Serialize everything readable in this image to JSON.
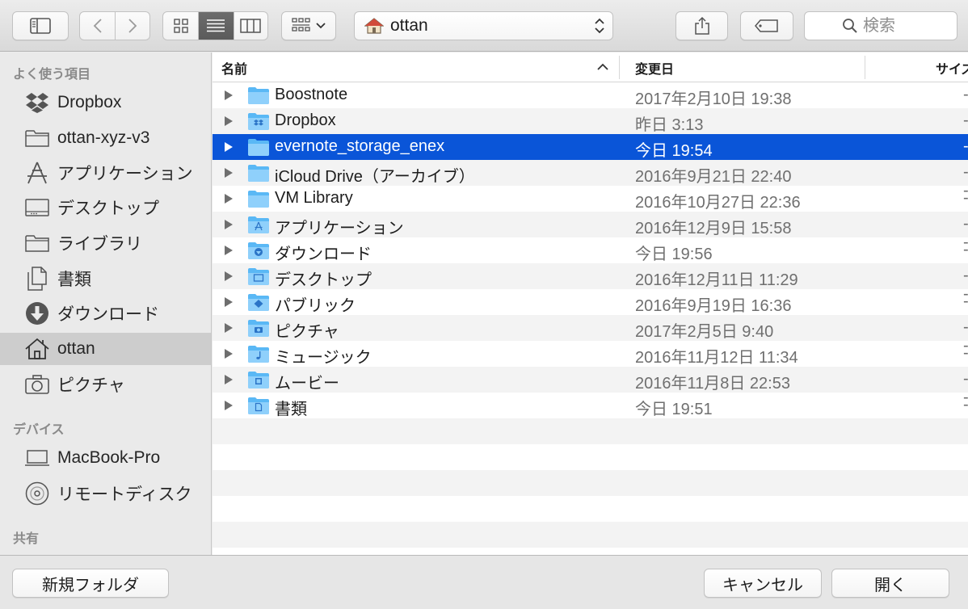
{
  "toolbar": {
    "location": "ottan",
    "search_placeholder": "検索"
  },
  "sidebar": {
    "favorites_header": "よく使う項目",
    "favorites": [
      {
        "label": "Dropbox",
        "icon": "dropbox-icon"
      },
      {
        "label": "ottan-xyz-v3",
        "icon": "folder-icon"
      },
      {
        "label": "アプリケーション",
        "icon": "applications-icon"
      },
      {
        "label": "デスクトップ",
        "icon": "desktop-icon"
      },
      {
        "label": "ライブラリ",
        "icon": "folder-icon"
      },
      {
        "label": "書類",
        "icon": "documents-icon"
      },
      {
        "label": "ダウンロード",
        "icon": "download-icon"
      },
      {
        "label": "ottan",
        "icon": "home-icon",
        "selected": true
      },
      {
        "label": "ピクチャ",
        "icon": "camera-icon"
      }
    ],
    "devices_header": "デバイス",
    "devices": [
      {
        "label": "MacBook-Pro",
        "icon": "laptop-icon"
      },
      {
        "label": "リモートディスク",
        "icon": "disc-icon"
      }
    ],
    "shared_header": "共有"
  },
  "columns": {
    "name": "名前",
    "modified": "変更日",
    "size": "サイズ"
  },
  "files": [
    {
      "name": "Boostnote",
      "date": "2017年2月10日 19:38",
      "size": "--",
      "icon": "folder-icon"
    },
    {
      "name": "Dropbox",
      "date": "昨日 3:13",
      "size": "--",
      "icon": "dropbox-folder-icon"
    },
    {
      "name": "evernote_storage_enex",
      "date": "今日 19:54",
      "size": "--",
      "icon": "folder-icon",
      "selected": true
    },
    {
      "name": "iCloud Drive（アーカイブ）",
      "date": "2016年9月21日 22:40",
      "size": "--",
      "icon": "folder-icon"
    },
    {
      "name": "VM Library",
      "date": "2016年10月27日 22:36",
      "size": "--",
      "icon": "folder-icon"
    },
    {
      "name": "アプリケーション",
      "date": "2016年12月9日 15:58",
      "size": "--",
      "icon": "applications-folder-icon"
    },
    {
      "name": "ダウンロード",
      "date": "今日 19:56",
      "size": "--",
      "icon": "downloads-folder-icon"
    },
    {
      "name": "デスクトップ",
      "date": "2016年12月11日 11:29",
      "size": "--",
      "icon": "desktop-folder-icon"
    },
    {
      "name": "パブリック",
      "date": "2016年9月19日 16:36",
      "size": "--",
      "icon": "public-folder-icon"
    },
    {
      "name": "ピクチャ",
      "date": "2017年2月5日 9:40",
      "size": "--",
      "icon": "pictures-folder-icon"
    },
    {
      "name": "ミュージック",
      "date": "2016年11月12日 11:34",
      "size": "--",
      "icon": "music-folder-icon"
    },
    {
      "name": "ムービー",
      "date": "2016年11月8日 22:53",
      "size": "--",
      "icon": "movies-folder-icon"
    },
    {
      "name": "書類",
      "date": "今日 19:51",
      "size": "--",
      "icon": "documents-folder-icon"
    }
  ],
  "buttons": {
    "new_folder": "新規フォルダ",
    "cancel": "キャンセル",
    "open": "開く"
  },
  "colors": {
    "selection": "#0a55d8",
    "folder": "#5ab8f5",
    "sidebar_selected": "#cdcdcd"
  }
}
